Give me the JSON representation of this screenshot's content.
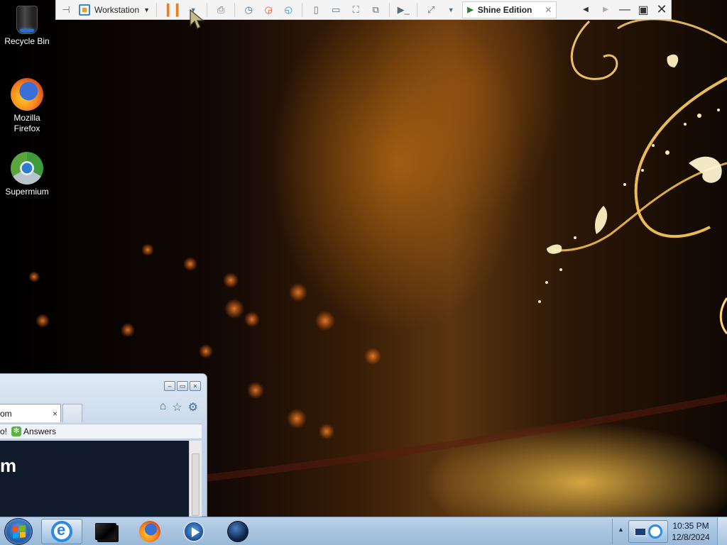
{
  "desktop": {
    "icons": [
      {
        "label": "Recycle Bin",
        "icon": "recycle-bin-icon"
      },
      {
        "label": "Mozilla\nFirefox",
        "label_line1": "Mozilla",
        "label_line2": "Firefox",
        "icon": "firefox-icon"
      },
      {
        "label": "Supermium",
        "icon": "supermium-icon"
      }
    ]
  },
  "vm_toolbar": {
    "workstation_label": "Workstation",
    "tab_label": "Shine Edition",
    "accent_color": "#f07d1c"
  },
  "browser": {
    "tab_title": "om",
    "tab_close": "×",
    "favorites": {
      "partial_text": "o!",
      "answers_label": "Answers"
    },
    "content_text": "m",
    "caption_buttons": {
      "minimize": "–",
      "restore": "▭",
      "close": "×"
    }
  },
  "taskbar": {
    "apps": [
      {
        "name": "Internet Explorer",
        "icon": "internet-explorer-icon",
        "active": true
      },
      {
        "name": "VMware",
        "icon": "vm-icon",
        "active": false
      },
      {
        "name": "Firefox",
        "icon": "firefox-icon",
        "active": false
      },
      {
        "name": "Media Player",
        "icon": "media-player-icon",
        "active": false
      },
      {
        "name": "Globe",
        "icon": "globe-icon",
        "active": false
      }
    ],
    "clock": {
      "time": "10:35 PM",
      "date": "12/8/2024"
    }
  }
}
